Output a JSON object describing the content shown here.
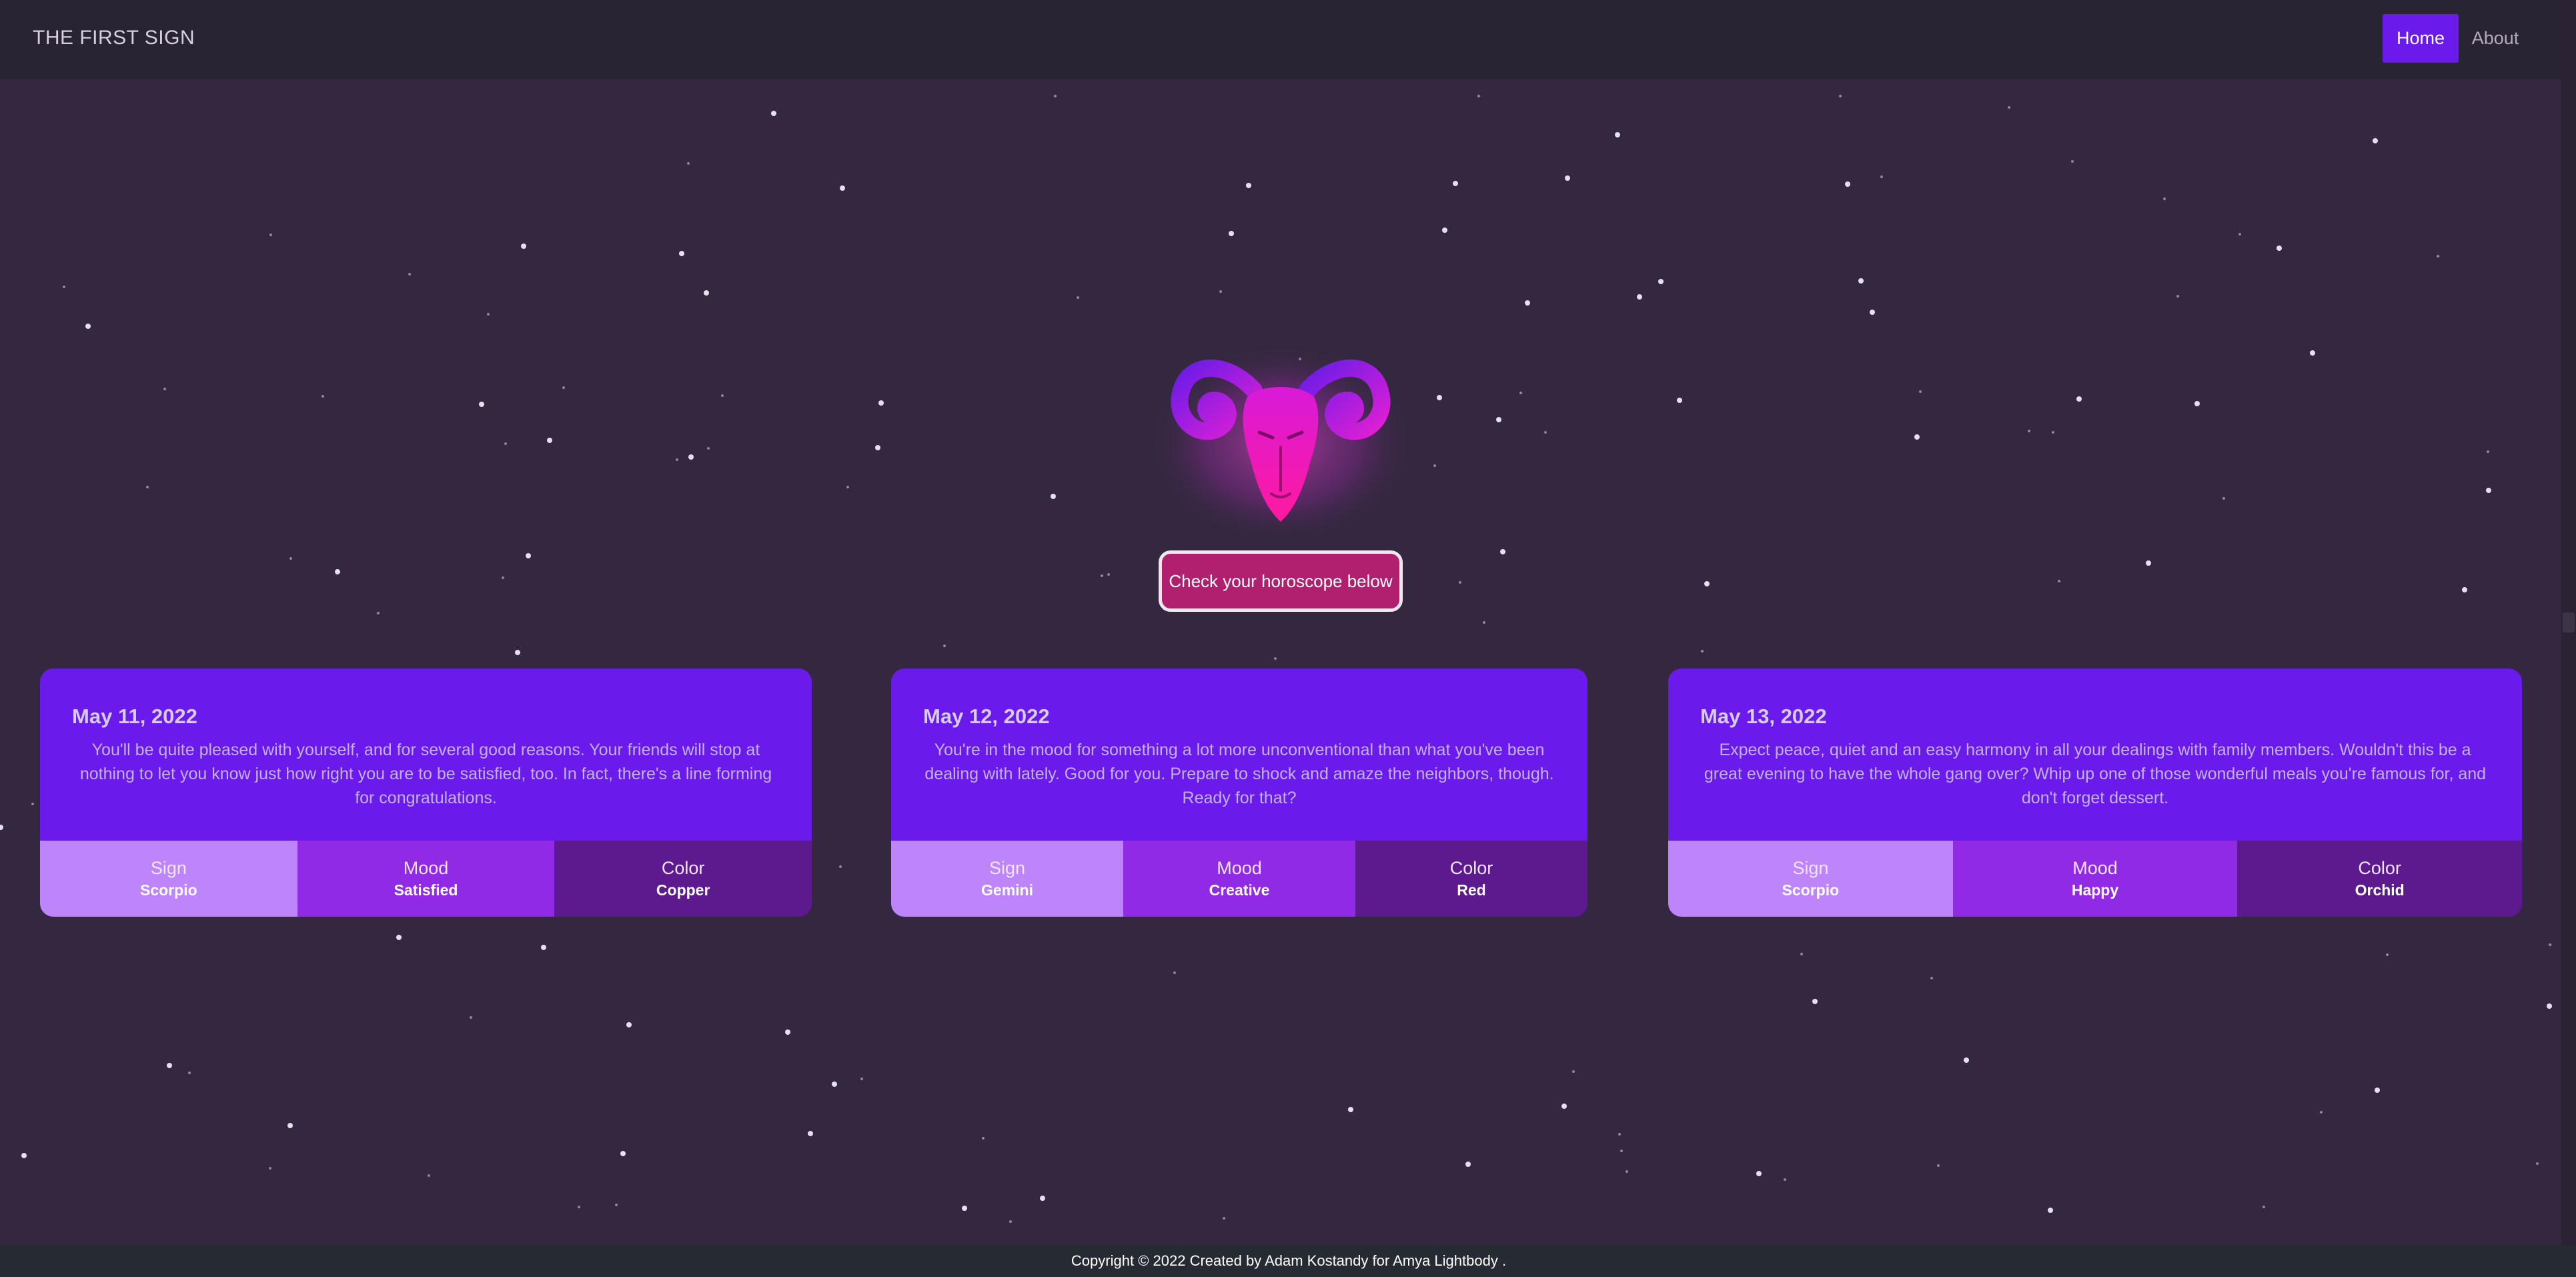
{
  "navbar": {
    "brand": "THE FIRST SIGN",
    "links": [
      "Home",
      "About"
    ]
  },
  "hero": {
    "button_label": "Check your horoscope below"
  },
  "cards": [
    {
      "date": "May 11, 2022",
      "text": "You'll be quite pleased with yourself, and for several good reasons. Your friends will stop at nothing to let you know just how right you are to be satisfied, too. In fact, there's a line forming for congratulations.",
      "sign_label": "Sign",
      "sign": "Scorpio",
      "mood_label": "Mood",
      "mood": "Satisfied",
      "color_label": "Color",
      "color": "Copper"
    },
    {
      "date": "May 12, 2022",
      "text": "You're in the mood for something a lot more unconventional than what you've been dealing with lately. Good for you. Prepare to shock and amaze the neighbors, though. Ready for that?",
      "sign_label": "Sign",
      "sign": "Gemini",
      "mood_label": "Mood",
      "mood": "Creative",
      "color_label": "Color",
      "color": "Red"
    },
    {
      "date": "May 13, 2022",
      "text": "Expect peace, quiet and an easy harmony in all your dealings with family members. Wouldn't this be a great evening to have the whole gang over? Whip up one of those wonderful meals you're famous for, and don't forget dessert.",
      "sign_label": "Sign",
      "sign": "Scorpio",
      "mood_label": "Mood",
      "mood": "Happy",
      "color_label": "Color",
      "color": "Orchid"
    }
  ],
  "footer": {
    "text": "Copyright © 2022 Created by Adam Kostandy for Amya Lightbody ."
  },
  "icons": {
    "emblem": "aries-ram-head-icon"
  },
  "colors": {
    "background": "#342840",
    "navbar": "#292433",
    "accent": "#6a1aeb",
    "button": "#b0206f",
    "sign_tile": "#bd85f9",
    "mood_tile": "#902ae5",
    "color_tile": "#5d1a8e",
    "emblem_pink": "#ff1aa8",
    "emblem_purple": "#7a1cf0"
  }
}
